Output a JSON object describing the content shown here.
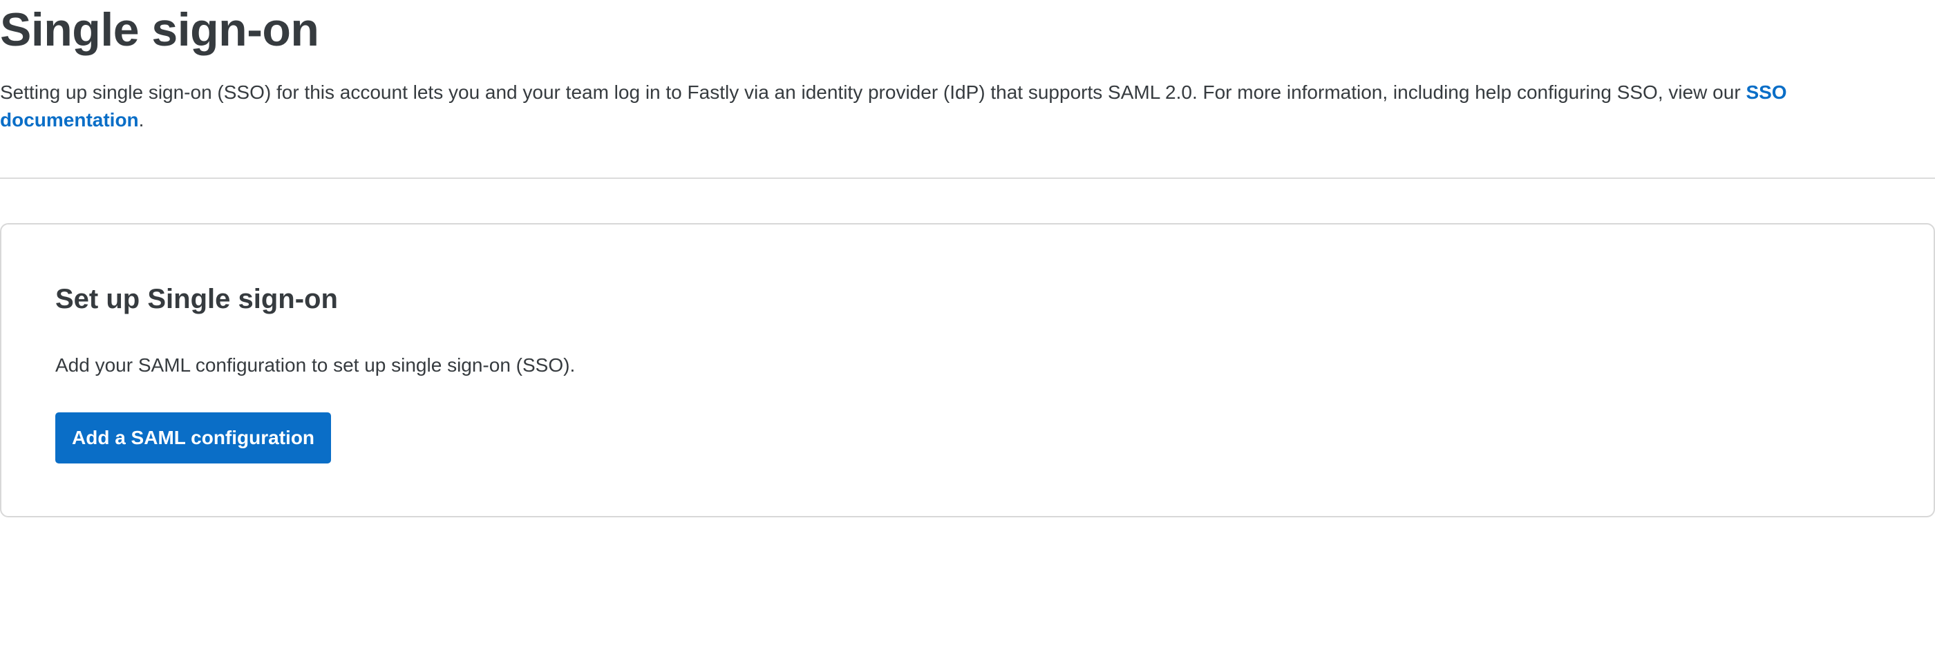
{
  "page": {
    "title": "Single sign-on",
    "intro_text": "Setting up single sign-on (SSO) for this account lets you and your team log in to Fastly via an identity provider (IdP) that supports SAML 2.0. For more information, including help configuring SSO, view our ",
    "intro_link": "SSO documentation",
    "intro_end": "."
  },
  "card": {
    "title": "Set up Single sign-on",
    "description": "Add your SAML configuration to set up single sign-on (SSO).",
    "button_label": "Add a SAML configuration"
  },
  "colors": {
    "text": "#363b3f",
    "link": "#0a6ec7",
    "button_bg": "#0a6ec7",
    "button_text": "#ffffff",
    "border": "#d8d8d8"
  }
}
